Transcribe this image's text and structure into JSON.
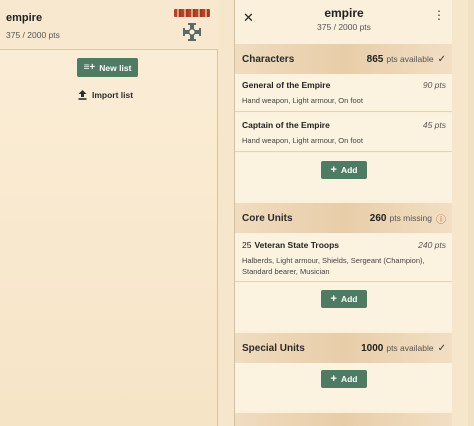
{
  "lists": [
    {
      "name": "empire",
      "points": "375 / 2000 pts"
    }
  ],
  "left_actions": {
    "new_list": "New list",
    "import_list": "Import list"
  },
  "editor": {
    "title": "empire",
    "points": "375 / 2000 pts",
    "close_icon": "close-icon",
    "menu_icon": "more-vert-icon"
  },
  "sections": [
    {
      "title": "Characters",
      "points": "865",
      "status": "pts available",
      "status_icon": "check-icon",
      "units": [
        {
          "count": "",
          "name": "General of the Empire",
          "points": "90 pts",
          "equipment": "Hand weapon, Light armour, On foot"
        },
        {
          "count": "",
          "name": "Captain of the Empire",
          "points": "45 pts",
          "equipment": "Hand weapon, Light armour, On foot"
        }
      ],
      "add_label": "Add"
    },
    {
      "title": "Core Units",
      "points": "260",
      "status": "pts missing",
      "status_icon": "warning-icon",
      "units": [
        {
          "count": "25",
          "name": "Veteran State Troops",
          "points": "240 pts",
          "equipment": "Halberds, Light armour, Shields, Sergeant (Champion), Standard bearer, Musician"
        }
      ],
      "add_label": "Add"
    },
    {
      "title": "Special Units",
      "points": "1000",
      "status": "pts available",
      "status_icon": "check-icon",
      "units": [],
      "add_label": "Add"
    }
  ],
  "colors": {
    "accent": "#4f7a63",
    "warning": "#d05a2a",
    "background": "#f5e6cc"
  }
}
